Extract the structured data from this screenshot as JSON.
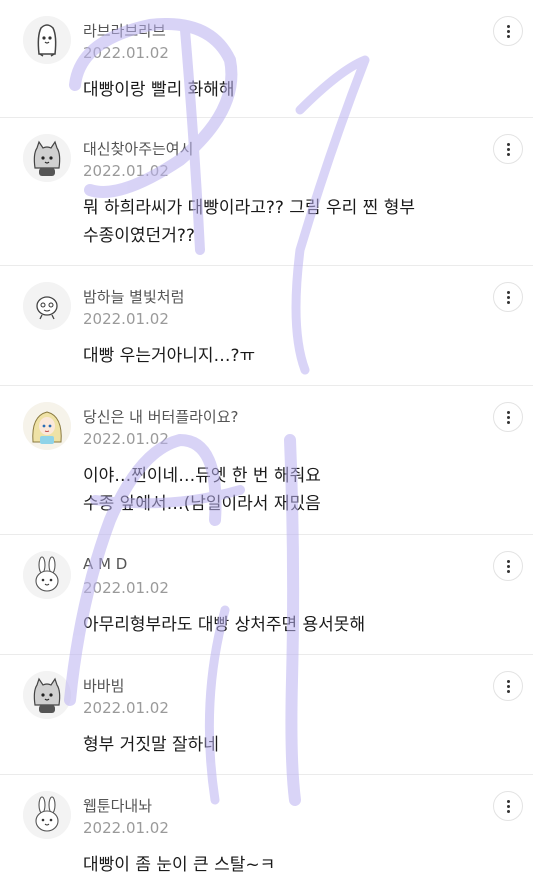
{
  "comments": [
    {
      "nickname": "라브라브라브",
      "date": "2022.01.02",
      "lines": [
        "대빵이랑 빨리 화해해"
      ],
      "avatar": "penguin-avatar"
    },
    {
      "nickname": "대신찾아주는여시",
      "date": "2022.01.02",
      "lines": [
        "뭐 하희라씨가 대빵이라고?? 그림 우리 찐 형부",
        "수종이였던거??"
      ],
      "avatar": "cat-avatar"
    },
    {
      "nickname": "밤하늘 별빛처럼",
      "date": "2022.01.02",
      "lines": [
        "대빵 우는거아니지…?ㅠ"
      ],
      "avatar": "creature-avatar"
    },
    {
      "nickname": "당신은 내 버터플라이요?",
      "date": "2022.01.02",
      "lines": [
        "이야…찐이네…듀엣 한 번 해줘요",
        "수종 앞에서…(남일이라서 재밌음"
      ],
      "avatar": "princess-avatar"
    },
    {
      "nickname": "A M D",
      "date": "2022.01.02",
      "lines": [
        "아무리형부라도 대빵 상처주면 용서못해"
      ],
      "avatar": "rabbit-avatar"
    },
    {
      "nickname": "바바빔",
      "date": "2022.01.02",
      "lines": [
        "형부 거짓말 잘하네"
      ],
      "avatar": "cat-avatar"
    },
    {
      "nickname": "웹툰다내놔",
      "date": "2022.01.02",
      "lines": [
        "대빵이 좀 눈이 큰 스탈~ㅋ"
      ],
      "avatar": "rabbit-avatar"
    }
  ],
  "more_icon": "more-vertical-icon",
  "colors": {
    "watermark": "#b9b0f0",
    "nickname": "#555555",
    "date": "#9a9a9a"
  }
}
